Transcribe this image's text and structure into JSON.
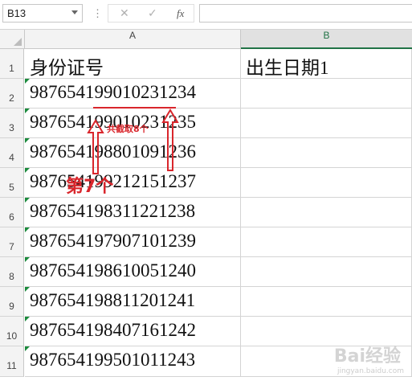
{
  "formula_bar": {
    "name_box": "B13",
    "dots": "⋮",
    "cancel_icon": "✕",
    "confirm_icon": "✓",
    "fx_label": "fx",
    "formula_value": ""
  },
  "columns": [
    "A",
    "B"
  ],
  "rows": [
    {
      "num": "1",
      "a": "身份证号",
      "b": "出生日期1",
      "flag": false
    },
    {
      "num": "2",
      "a": "987654199010231234",
      "b": "",
      "flag": true
    },
    {
      "num": "3",
      "a": "987654199010231235",
      "b": "",
      "flag": true
    },
    {
      "num": "4",
      "a": "987654198801091236",
      "b": "",
      "flag": true
    },
    {
      "num": "5",
      "a": "987654199212151237",
      "b": "",
      "flag": true
    },
    {
      "num": "6",
      "a": "987654198311221238",
      "b": "",
      "flag": true
    },
    {
      "num": "7",
      "a": "987654197907101239",
      "b": "",
      "flag": true
    },
    {
      "num": "8",
      "a": "987654198610051240",
      "b": "",
      "flag": true
    },
    {
      "num": "9",
      "a": "987654198811201241",
      "b": "",
      "flag": true
    },
    {
      "num": "10",
      "a": "987654198407161242",
      "b": "",
      "flag": true
    },
    {
      "num": "11",
      "a": "987654199501011243",
      "b": "",
      "flag": true
    }
  ],
  "annotations": {
    "span_label": "共截取8个",
    "start_label": "第7个",
    "color": "#d9262c"
  },
  "watermark": {
    "text": "Bai经验",
    "sub": "jingyan.baidu.com"
  }
}
